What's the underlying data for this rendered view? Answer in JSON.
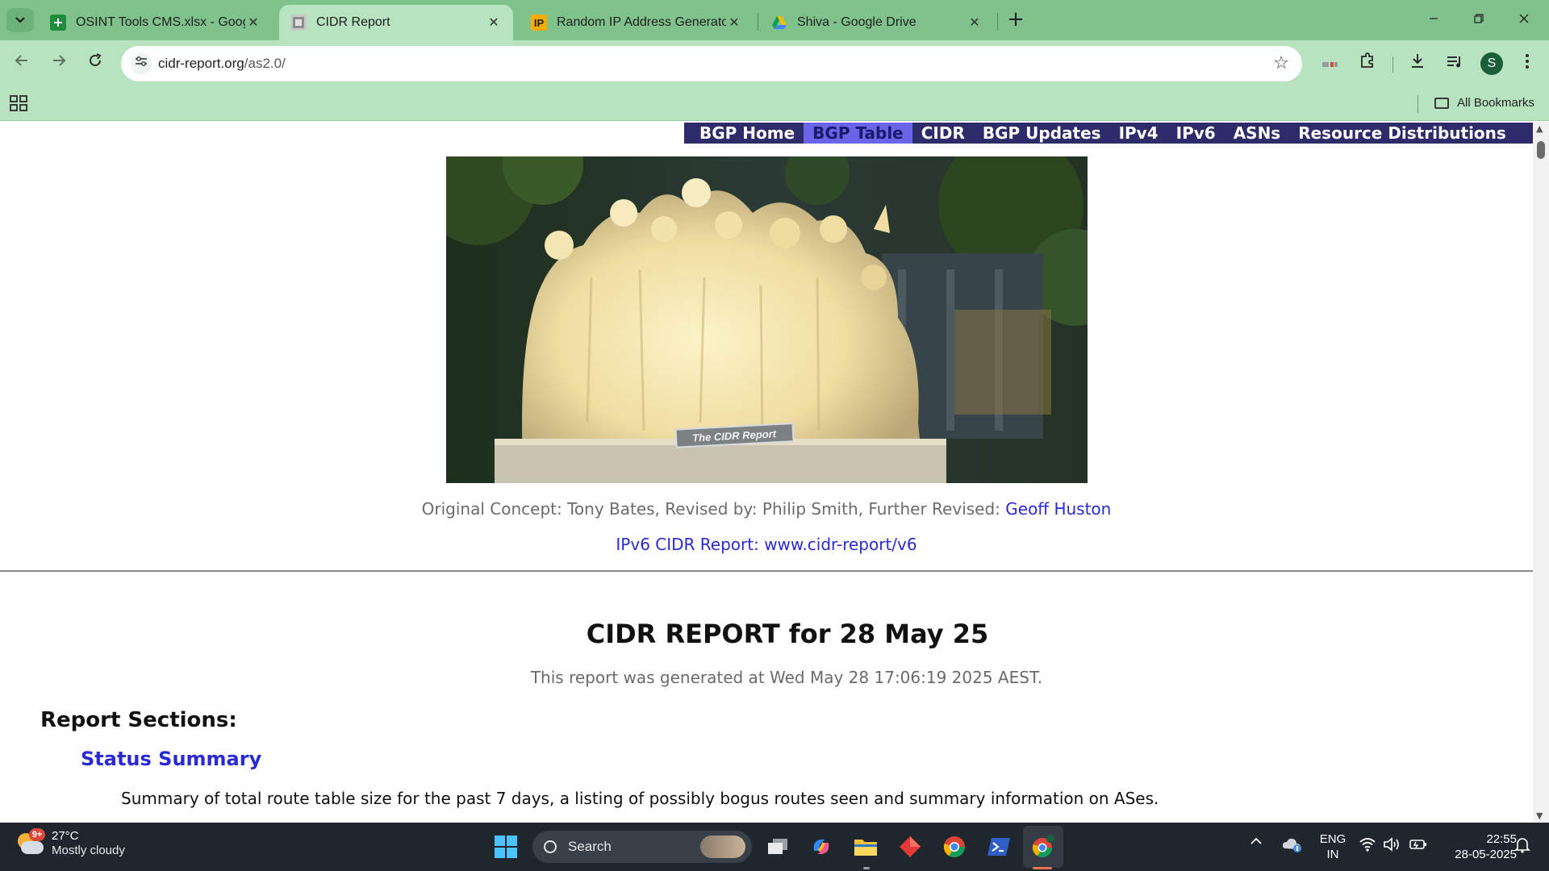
{
  "browser": {
    "tabs": [
      {
        "title": "OSINT Tools CMS.xlsx - Google",
        "icon": "sheets-icon",
        "color": "#1e8e3e"
      },
      {
        "title": "CIDR Report",
        "icon": "page-icon",
        "active": true
      },
      {
        "title": "Random IP Address Generator,",
        "icon": "ip-icon",
        "color": "#f9ab00",
        "icon_text": "IP"
      },
      {
        "title": "Shiva - Google Drive",
        "icon": "drive-icon"
      }
    ],
    "new_tab_label": "+",
    "url_host": "cidr-report.org",
    "url_path": "/as2.0/",
    "profile_initial": "S",
    "all_bookmarks_label": "All Bookmarks"
  },
  "site_nav": {
    "items": [
      "BGP Home",
      "BGP Table",
      "CIDR",
      "BGP Updates",
      "IPv4",
      "IPv6",
      "ASNs",
      "Resource Distributions"
    ],
    "current": "BGP Table"
  },
  "hero": {
    "plaque_text": "The CIDR Report"
  },
  "credits": {
    "prefix": "Original Concept: Tony Bates, Revised by: Philip Smith, Further Revised: ",
    "link": "Geoff Huston"
  },
  "ipv6_link": "IPv6 CIDR Report: www.cidr-report/v6",
  "report": {
    "title": "CIDR REPORT for 28 May 25",
    "generated": "This report was generated at Wed May 28 17:06:19 2025 AEST.",
    "sections_heading": "Report Sections:",
    "status_summary_link": "Status Summary",
    "status_summary_desc": "Summary of total route table size for the past 7 days, a listing of possibly bogus routes seen and summary information on ASes."
  },
  "taskbar": {
    "weather_temp": "27°C",
    "weather_cond": "Mostly cloudy",
    "weather_badge": "9+",
    "search_label": "Search",
    "lang_line1": "ENG",
    "lang_line2": "IN",
    "time": "22:55",
    "date": "28-05-2025"
  },
  "colors": {
    "chrome_green": "#7fc28b",
    "toolbar_green": "#b8e3bf",
    "site_nav_bg": "#2e2b6b",
    "site_nav_current": "#6a64e8",
    "link_blue": "#2a2ad4"
  }
}
